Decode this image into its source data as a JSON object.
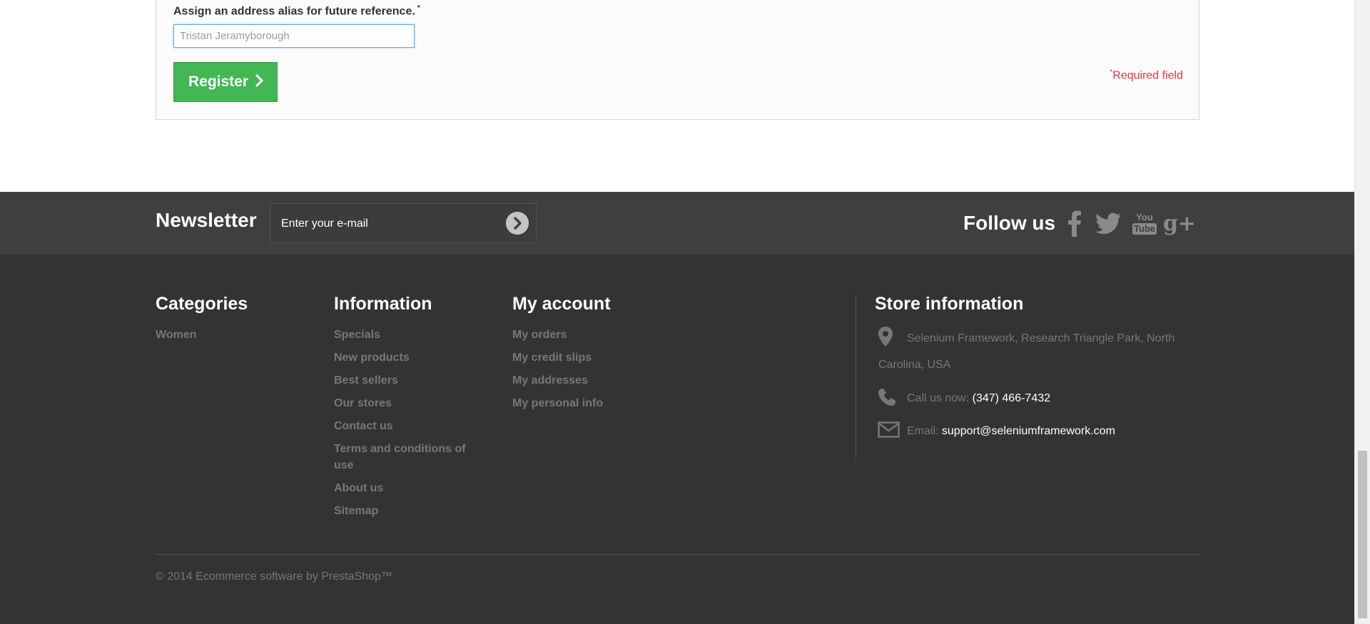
{
  "form": {
    "alias_label": "Assign an address alias for future reference.",
    "required_mark": "*",
    "alias_value": "Tristan Jeramyborough",
    "register_label": "Register",
    "required_note_mark": "*",
    "required_note_text": "Required field"
  },
  "newsletter": {
    "title": "Newsletter",
    "placeholder": "Enter your e-mail"
  },
  "follow": {
    "title": "Follow us",
    "networks": [
      "facebook-icon",
      "twitter-icon",
      "youtube-icon",
      "google-plus-icon"
    ],
    "youtube_top": "You",
    "youtube_bottom": "Tube",
    "google_plus": "g+"
  },
  "footer": {
    "categories": {
      "title": "Categories",
      "items": [
        "Women"
      ]
    },
    "information": {
      "title": "Information",
      "items": [
        "Specials",
        "New products",
        "Best sellers",
        "Our stores",
        "Contact us",
        "Terms and conditions of use",
        "About us",
        "Sitemap"
      ]
    },
    "account": {
      "title": "My account",
      "items": [
        "My orders",
        "My credit slips",
        "My addresses",
        "My personal info"
      ]
    },
    "store": {
      "title": "Store information",
      "address_line1": "Selenium Framework, Research Triangle Park, North",
      "address_line2": "Carolina, USA",
      "call_label": "Call us now:",
      "phone": "(347) 466-7432",
      "email_label": "Email:",
      "email": "support@seleniumframework.com"
    },
    "copyright": "© 2014 Ecommerce software by PrestaShop™"
  },
  "colors": {
    "accent_green": "#43b754",
    "required_red": "#f13340",
    "footer_bg": "#333333",
    "newsletter_bg": "#3f3f3f"
  }
}
